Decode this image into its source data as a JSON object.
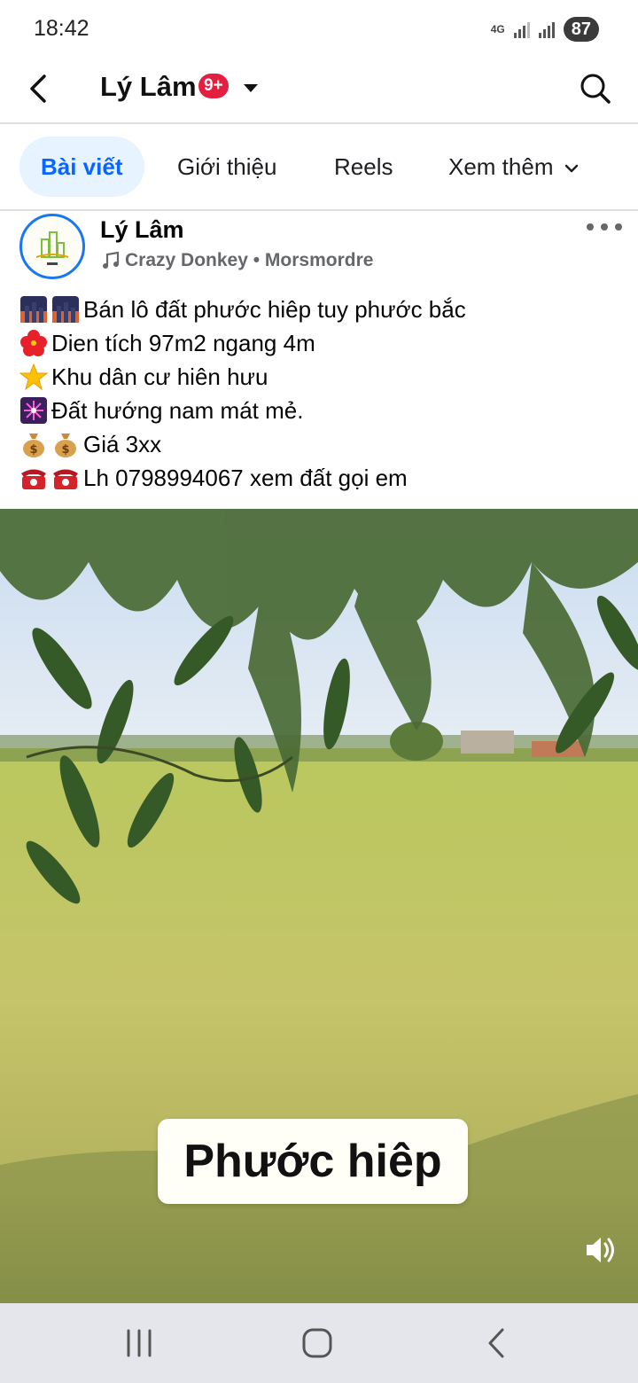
{
  "status_bar": {
    "time": "18:42",
    "network": "4G",
    "battery": "87"
  },
  "top_bar": {
    "profile_name": "Lý Lâm",
    "notification_badge": "9+"
  },
  "tabs": [
    {
      "label": "Bài viết",
      "active": true
    },
    {
      "label": "Giới thiệu",
      "active": false
    },
    {
      "label": "Reels",
      "active": false
    },
    {
      "label": "Xem thêm",
      "active": false
    }
  ],
  "post": {
    "author": "Lý Lâm",
    "audio": "Crazy Donkey • Morsmordre",
    "lines": [
      {
        "icons": [
          "city-dusk-emoji",
          "city-dusk-emoji"
        ],
        "text": "Bán lô đất phước hiêp tuy phước bắc"
      },
      {
        "icons": [
          "hibiscus-emoji"
        ],
        "text": "Dien tích 97m2 ngang 4m"
      },
      {
        "icons": [
          "star-emoji"
        ],
        "text": "Khu dân cư hiên hưu"
      },
      {
        "icons": [
          "sparkler-emoji"
        ],
        "text": "Đất hướng nam mát mẻ."
      },
      {
        "icons": [
          "money-bag-emoji",
          "money-bag-emoji"
        ],
        "text": "Giá 3xx"
      },
      {
        "icons": [
          "telephone-emoji",
          "telephone-emoji"
        ],
        "text": "Lh 0798994067 xem đất gọi em"
      }
    ],
    "video_caption": "Phước hiêp"
  },
  "colors": {
    "accent": "#0866ff",
    "active_tab_bg": "#e7f3ff",
    "badge": "#e41e3f",
    "secondary_text": "#65676b"
  }
}
